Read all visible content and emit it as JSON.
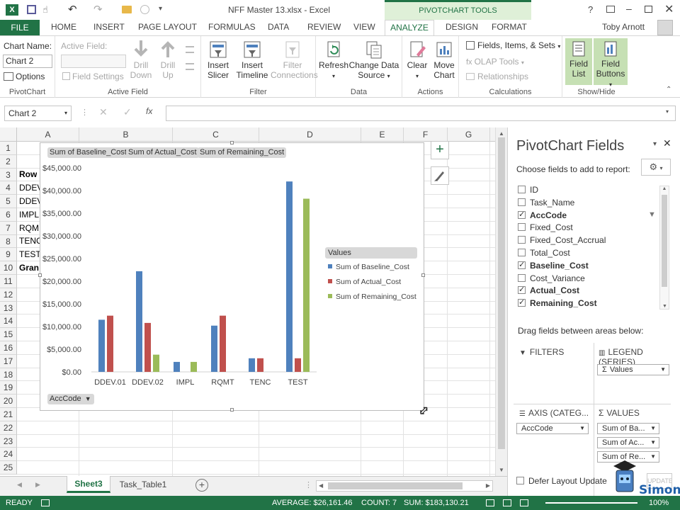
{
  "window": {
    "title": "NFF Master 13.xlsx - Excel",
    "context_tools": "PIVOTCHART TOOLS",
    "user": "Toby Arnott",
    "help": "?"
  },
  "tabs": [
    "FILE",
    "HOME",
    "INSERT",
    "PAGE LAYOUT",
    "FORMULAS",
    "DATA",
    "REVIEW",
    "VIEW",
    "ANALYZE",
    "DESIGN",
    "FORMAT"
  ],
  "ribbon": {
    "pivotchart": {
      "chart_name_label": "Chart Name:",
      "chart_name_value": "Chart 2",
      "options": "Options",
      "group": "PivotChart"
    },
    "active_field": {
      "label": "Active Field:",
      "field_settings": "Field Settings",
      "drill_down_1": "Drill",
      "drill_down_2": "Down",
      "drill_up_1": "Drill",
      "drill_up_2": "Up",
      "group": "Active Field"
    },
    "filter": {
      "slicer_1": "Insert",
      "slicer_2": "Slicer",
      "timeline_1": "Insert",
      "timeline_2": "Timeline",
      "conn_1": "Filter",
      "conn_2": "Connections",
      "group": "Filter"
    },
    "data": {
      "refresh": "Refresh",
      "change_1": "Change Data",
      "change_2": "Source",
      "group": "Data"
    },
    "actions": {
      "clear": "Clear",
      "move_1": "Move",
      "move_2": "Chart",
      "group": "Actions"
    },
    "calculations": {
      "fields": "Fields, Items, & Sets",
      "olap": "OLAP Tools",
      "relationships": "Relationships",
      "group": "Calculations"
    },
    "showhide": {
      "fieldlist_1": "Field",
      "fieldlist_2": "List",
      "fieldbuttons_1": "Field",
      "fieldbuttons_2": "Buttons",
      "group": "Show/Hide"
    }
  },
  "formula_bar": {
    "name_box": "Chart 2",
    "fx": "fx",
    "value": ""
  },
  "grid": {
    "columns": [
      "A",
      "B",
      "C",
      "D",
      "E",
      "F",
      "G"
    ],
    "rows": [
      "1",
      "2",
      "3",
      "4",
      "5",
      "6",
      "7",
      "8",
      "9",
      "10",
      "11",
      "12",
      "13",
      "14",
      "15",
      "16",
      "17",
      "18",
      "19",
      "20",
      "21",
      "22",
      "23",
      "24",
      "25"
    ],
    "col_a_cells": [
      "",
      "",
      "Row",
      "DDEV",
      "DDEV",
      "IMPL",
      "RQM",
      "TENC",
      "TEST",
      "Gran"
    ]
  },
  "chart_data": {
    "type": "bar",
    "categories": [
      "DDEV.01",
      "DDEV.02",
      "IMPL",
      "RQMT",
      "TENC",
      "TEST"
    ],
    "series": [
      {
        "name": "Sum of Baseline_Cost",
        "color": "#4f81bd",
        "values": [
          11500,
          22200,
          2200,
          10200,
          3000,
          42000
        ]
      },
      {
        "name": "Sum of Actual_Cost",
        "color": "#c0504d",
        "values": [
          12400,
          10800,
          0,
          12400,
          3000,
          3000
        ]
      },
      {
        "name": "Sum of Remaining_Cost",
        "color": "#9bbb59",
        "values": [
          0,
          3800,
          2200,
          0,
          0,
          38200
        ]
      }
    ],
    "ylim": [
      0,
      45000
    ],
    "yticks": [
      "$0.00",
      "$5,000.00",
      "$10,000.00",
      "$15,000.00",
      "$20,000.00",
      "$25,000.00",
      "$30,000.00",
      "$35,000.00",
      "$40,000.00",
      "$45,000.00"
    ],
    "field_buttons": [
      "Sum of Baseline_Cost",
      "Sum of Actual_Cost",
      "Sum of Remaining_Cost"
    ],
    "axis_field_button": "AccCode",
    "legend_title": "Values",
    "legend_position": "right",
    "grid": false
  },
  "chart_tools": {
    "add": "+",
    "style": "brush"
  },
  "pane": {
    "title": "PivotChart Fields",
    "choose": "Choose fields to add to report:",
    "fields": [
      {
        "name": "ID",
        "checked": false,
        "bold": false
      },
      {
        "name": "Task_Name",
        "checked": false,
        "bold": false
      },
      {
        "name": "AccCode",
        "checked": true,
        "bold": true
      },
      {
        "name": "Fixed_Cost",
        "checked": false,
        "bold": false
      },
      {
        "name": "Fixed_Cost_Accrual",
        "checked": false,
        "bold": false
      },
      {
        "name": "Total_Cost",
        "checked": false,
        "bold": false
      },
      {
        "name": "Baseline_Cost",
        "checked": true,
        "bold": true
      },
      {
        "name": "Cost_Variance",
        "checked": false,
        "bold": false
      },
      {
        "name": "Actual_Cost",
        "checked": true,
        "bold": true
      },
      {
        "name": "Remaining_Cost",
        "checked": true,
        "bold": true
      }
    ],
    "drag_label": "Drag fields between areas below:",
    "filters": "FILTERS",
    "legend_series": "LEGEND (SERIES)",
    "legend_item": "Values",
    "axis": "AXIS (CATEG...",
    "axis_item": "AccCode",
    "values": "VALUES",
    "values_items": [
      "Sum of Ba...",
      "Sum of Ac...",
      "Sum of Re..."
    ],
    "defer": "Defer Layout Update",
    "update": "UPDATE"
  },
  "sheet_tabs": [
    "Sheet3",
    "Task_Table1"
  ],
  "status": {
    "ready": "READY",
    "average": "AVERAGE: $26,161.46",
    "count": "COUNT: 7",
    "sum": "SUM: $183,130.21",
    "zoom": "100%"
  },
  "watermark": "Simon"
}
